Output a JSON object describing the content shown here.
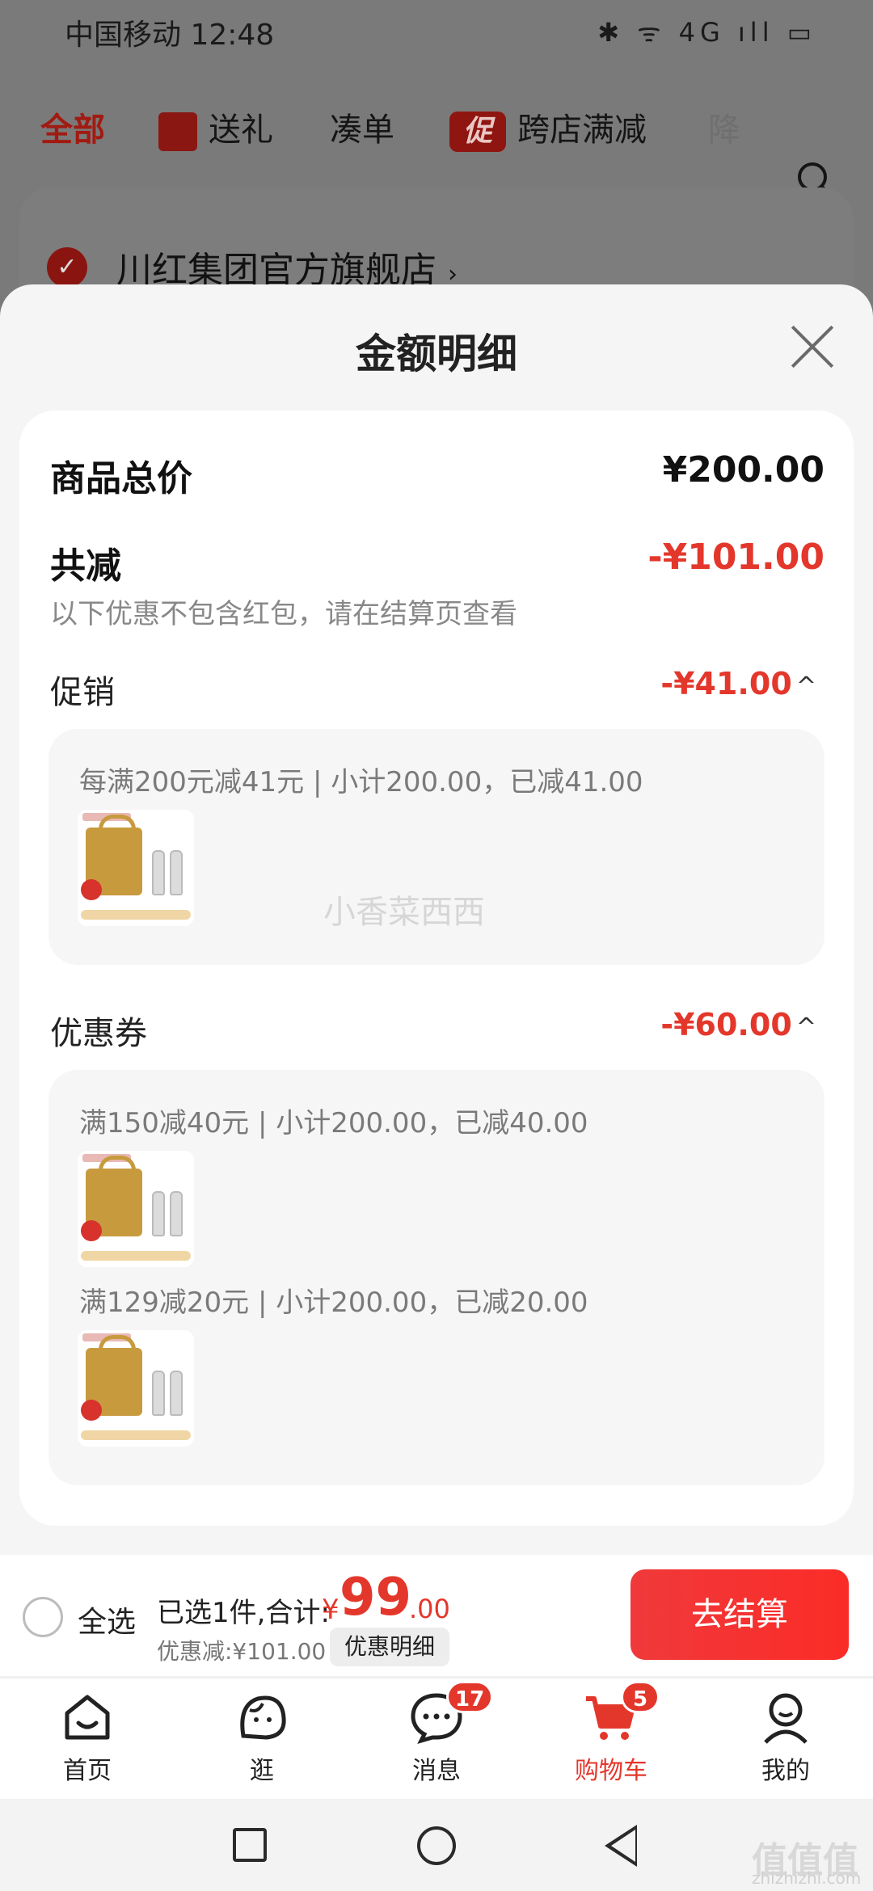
{
  "status_bar": {
    "carrier_time": "中国移动 12:48",
    "icons": "✱ ᯤ 4G ıll ▭"
  },
  "top_nav": {
    "tabs": [
      "全部",
      "送礼",
      "凑单",
      "跨店满减",
      "降"
    ],
    "promo_badge": "促"
  },
  "store": {
    "name": "川红集团官方旗舰店",
    "chevron": "›",
    "check": "✓"
  },
  "sheet": {
    "title": "金额明细",
    "total_label": "商品总价",
    "total_value": "¥200.00",
    "reduce_label": "共减",
    "reduce_value": "-¥101.00",
    "reduce_note": "以下优惠不包含红包，请在结算页查看",
    "promo": {
      "label": "促销",
      "value": "-¥41.00",
      "caret": "^",
      "line": "每满200元减41元 | 小计200.00，已减41.00"
    },
    "coupon": {
      "label": "优惠券",
      "value": "-¥60.00",
      "caret": "^",
      "line1": "满150减40元 | 小计200.00，已减40.00",
      "line2": "满129减20元 | 小计200.00，已减20.00"
    },
    "watermark": "小香菜西西"
  },
  "checkout": {
    "select_all": "全选",
    "selected_text": "已选1件,合计:",
    "currency": "¥",
    "price_int": "99",
    "price_dec": ".00",
    "discount_text": "优惠减:¥101.00",
    "detail_button": "优惠明细",
    "checkout_button": "去结算"
  },
  "tabbar": {
    "items": [
      {
        "label": "首页",
        "icon": "home-icon"
      },
      {
        "label": "逛",
        "icon": "explore-icon"
      },
      {
        "label": "消息",
        "icon": "message-icon",
        "badge": "17"
      },
      {
        "label": "购物车",
        "icon": "cart-icon",
        "badge": "5",
        "active": true
      },
      {
        "label": "我的",
        "icon": "profile-icon"
      }
    ]
  },
  "corner_watermark": {
    "big": "值值值",
    "small": "zhizhizhi.com"
  },
  "colors": {
    "accent": "#e4372c",
    "button": "#f0393b"
  }
}
